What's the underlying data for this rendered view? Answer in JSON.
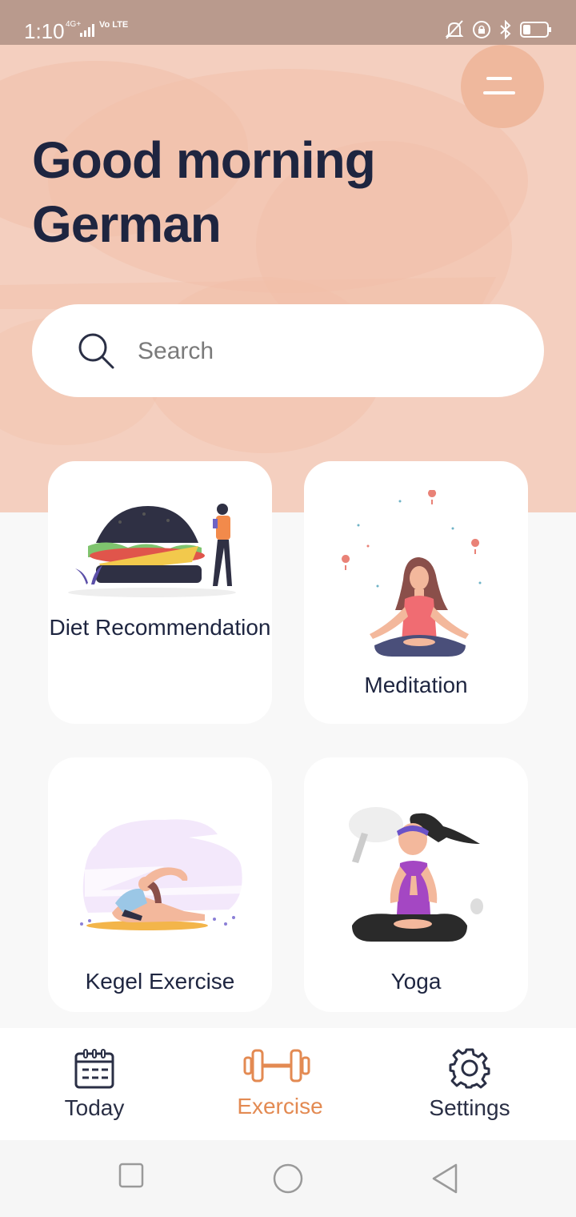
{
  "status_bar": {
    "time": "1:10",
    "network": "4G+",
    "volte": "Vo LTE"
  },
  "header": {
    "greeting_line1": "Good morning",
    "greeting_line2": "German",
    "menu_icon": "menu-icon"
  },
  "search": {
    "placeholder": "Search",
    "value": "",
    "icon": "search-icon"
  },
  "categories": [
    {
      "label": "Diet Recommendation",
      "illustration": "burger-person-illustration"
    },
    {
      "label": "Meditation",
      "illustration": "meditation-illustration"
    },
    {
      "label": "Kegel Exercise",
      "illustration": "stretching-illustration"
    },
    {
      "label": "Yoga",
      "illustration": "yoga-illustration"
    }
  ],
  "bottom_nav": {
    "items": [
      {
        "label": "Today",
        "icon": "calendar-icon",
        "active": false
      },
      {
        "label": "Exercise",
        "icon": "dumbbell-icon",
        "active": true
      },
      {
        "label": "Settings",
        "icon": "gear-icon",
        "active": false
      }
    ]
  },
  "colors": {
    "hero_background": "#f4cfbf",
    "menu_button": "#efb89d",
    "heading_text": "#1e2540",
    "accent": "#e38a52",
    "status_bar": "#b99a8d"
  }
}
